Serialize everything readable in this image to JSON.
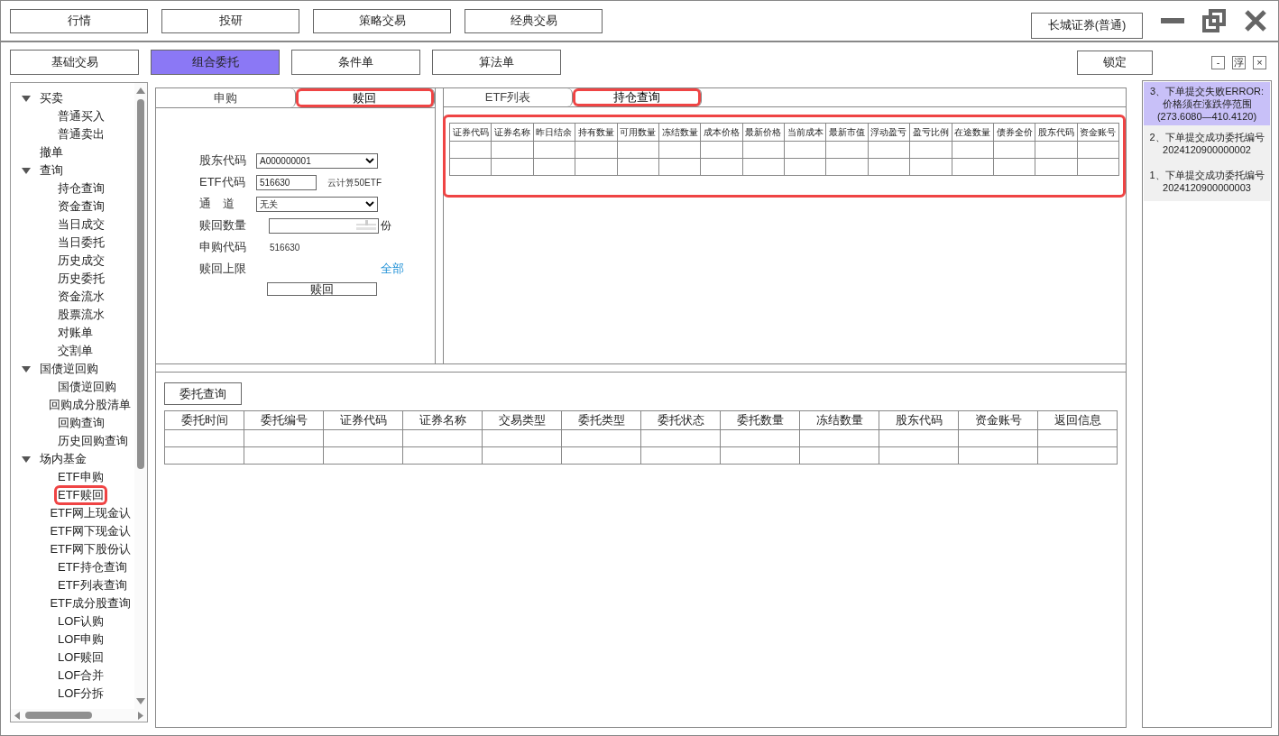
{
  "top_nav": [
    {
      "label": "行情"
    },
    {
      "label": "投研"
    },
    {
      "label": "策略交易"
    },
    {
      "label": "经典交易"
    }
  ],
  "account_button": "长城证券(普通)",
  "sub_tabs": [
    {
      "label": "基础交易",
      "selected": false
    },
    {
      "label": "组合委托",
      "selected": true
    },
    {
      "label": "条件单",
      "selected": false
    },
    {
      "label": "算法单",
      "selected": false
    }
  ],
  "lock_button": "锁定",
  "panel_buttons": [
    {
      "label": "-"
    },
    {
      "label": "浮"
    },
    {
      "label": "×"
    }
  ],
  "tree": [
    {
      "label": "买卖",
      "expanded": true,
      "highlighted": false,
      "children": [
        {
          "label": "普通买入",
          "highlighted": false
        },
        {
          "label": "普通卖出",
          "highlighted": false
        }
      ]
    },
    {
      "label": "撤单",
      "highlighted": false
    },
    {
      "label": "查询",
      "expanded": true,
      "highlighted": false,
      "children": [
        {
          "label": "持仓查询",
          "highlighted": false
        },
        {
          "label": "资金查询",
          "highlighted": false
        },
        {
          "label": "当日成交",
          "highlighted": false
        },
        {
          "label": "当日委托",
          "highlighted": false
        },
        {
          "label": "历史成交",
          "highlighted": false
        },
        {
          "label": "历史委托",
          "highlighted": false
        },
        {
          "label": "资金流水",
          "highlighted": false
        },
        {
          "label": "股票流水",
          "highlighted": false
        },
        {
          "label": "对账单",
          "highlighted": false
        },
        {
          "label": "交割单",
          "highlighted": false
        }
      ]
    },
    {
      "label": "国债逆回购",
      "expanded": true,
      "highlighted": false,
      "children": [
        {
          "label": "国债逆回购",
          "highlighted": false
        },
        {
          "label": "回购成分股清单",
          "highlighted": false
        },
        {
          "label": "回购查询",
          "highlighted": false
        },
        {
          "label": "历史回购查询",
          "highlighted": false
        }
      ]
    },
    {
      "label": "场内基金",
      "expanded": true,
      "highlighted": false,
      "children": [
        {
          "label": "ETF申购",
          "highlighted": false
        },
        {
          "label": "ETF赎回",
          "highlighted": true
        },
        {
          "label": "ETF网上现金认",
          "highlighted": false
        },
        {
          "label": "ETF网下现金认",
          "highlighted": false
        },
        {
          "label": "ETF网下股份认",
          "highlighted": false
        },
        {
          "label": "ETF持仓查询",
          "highlighted": false
        },
        {
          "label": "ETF列表查询",
          "highlighted": false
        },
        {
          "label": "ETF成分股查询",
          "highlighted": false
        },
        {
          "label": "LOF认购",
          "highlighted": false
        },
        {
          "label": "LOF申购",
          "highlighted": false
        },
        {
          "label": "LOF赎回",
          "highlighted": false
        },
        {
          "label": "LOF合并",
          "highlighted": false
        },
        {
          "label": "LOF分拆",
          "highlighted": false
        }
      ]
    }
  ],
  "form_tabs": [
    {
      "label": "申购",
      "selected": false,
      "highlighted": false
    },
    {
      "label": "赎回",
      "selected": true,
      "highlighted": true
    }
  ],
  "form": {
    "fields": [
      {
        "kind": "select",
        "label": "股东代码",
        "value": "A000000001"
      },
      {
        "kind": "input",
        "label": "ETF代码",
        "value": "516630",
        "note": "云计算50ETF"
      },
      {
        "kind": "select",
        "label": "通　道",
        "value": "无关"
      },
      {
        "kind": "spin",
        "label": "赎回数量",
        "unit": "份"
      },
      {
        "kind": "text",
        "label": "申购代码",
        "value": "516630"
      },
      {
        "kind": "link",
        "label": "赎回上限",
        "link": "全部"
      }
    ],
    "submit": "赎回"
  },
  "right_tabs": [
    {
      "label": "ETF列表",
      "selected": false,
      "highlighted": false
    },
    {
      "label": "持仓查询",
      "selected": true,
      "highlighted": true
    }
  ],
  "holdings_table": {
    "highlighted": true,
    "columns": [
      "证券代码",
      "证券名称",
      "昨日结余",
      "持有数量",
      "可用数量",
      "冻结数量",
      "成本价格",
      "最新价格",
      "当前成本",
      "最新市值",
      "浮动盈亏",
      "盈亏比例",
      "在途数量",
      "债券全价",
      "股东代码",
      "资金账号"
    ]
  },
  "orders": {
    "button": "委托查询",
    "columns": [
      "委托时间",
      "委托编号",
      "证券代码",
      "证券名称",
      "交易类型",
      "委托类型",
      "委托状态",
      "委托数量",
      "冻结数量",
      "股东代码",
      "资金账号",
      "返回信息"
    ]
  },
  "messages": [
    {
      "text": "3、下单提交失败ERROR:价格须在涨跌停范围(273.6080—410.4120)",
      "selected": true
    },
    {
      "text": "2、下单提交成功委托编号",
      "detail": "2024120900000002",
      "selected": false
    },
    {
      "text": "1、下单提交成功委托编号",
      "detail": "2024120900000003",
      "selected": false
    }
  ]
}
